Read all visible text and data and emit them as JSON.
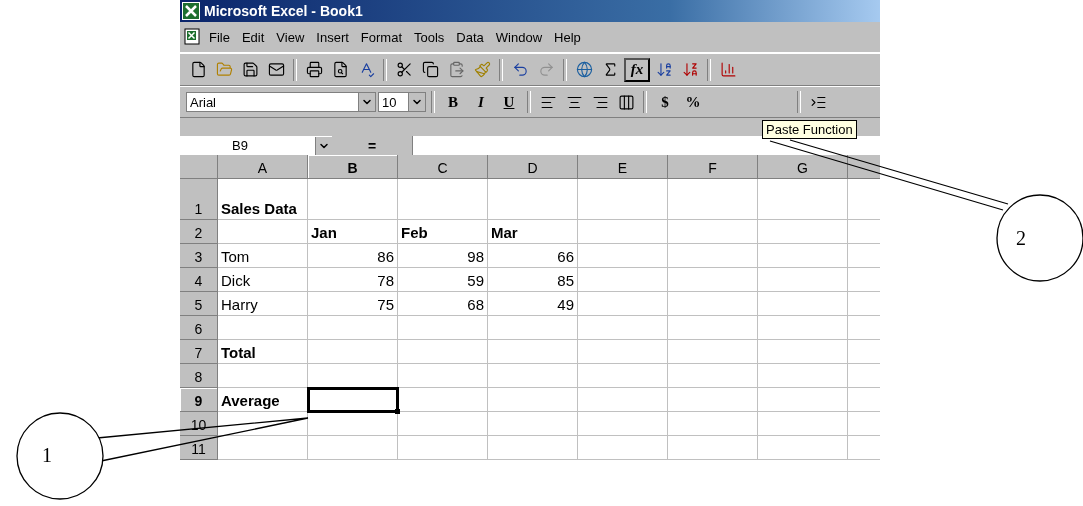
{
  "window": {
    "title": "Microsoft Excel - Book1"
  },
  "menu": [
    "File",
    "Edit",
    "View",
    "Insert",
    "Format",
    "Tools",
    "Data",
    "Window",
    "Help"
  ],
  "standard_toolbar": {
    "function_button": {
      "label": "fx",
      "highlighted": true
    }
  },
  "formatting_toolbar": {
    "font": "Arial",
    "size": "10",
    "style_buttons": [
      "B",
      "I",
      "U"
    ],
    "currency": "$",
    "percent": "%"
  },
  "tooltip": "Paste Function",
  "formula_bar": {
    "name_box": "B9",
    "equals": "="
  },
  "columns": [
    {
      "label": "A",
      "selected": false
    },
    {
      "label": "B",
      "selected": true
    },
    {
      "label": "C",
      "selected": false
    },
    {
      "label": "D",
      "selected": false
    },
    {
      "label": "E",
      "selected": false
    },
    {
      "label": "F",
      "selected": false
    },
    {
      "label": "G",
      "selected": false
    }
  ],
  "rows": [
    {
      "number": "1",
      "selected": false,
      "cells": [
        {
          "text": "Sales Data",
          "bold": true,
          "kind": "label",
          "selected": false
        },
        {
          "selected": false
        },
        {
          "selected": false
        },
        {
          "selected": false
        },
        {
          "selected": false
        },
        {
          "selected": false
        },
        {
          "selected": false
        }
      ]
    },
    {
      "number": "2",
      "selected": false,
      "cells": [
        {
          "selected": false
        },
        {
          "text": "Jan",
          "bold": true,
          "kind": "label",
          "selected": false
        },
        {
          "text": "Feb",
          "bold": true,
          "kind": "label",
          "selected": false
        },
        {
          "text": "Mar",
          "bold": true,
          "kind": "label",
          "selected": false
        },
        {
          "selected": false
        },
        {
          "selected": false
        },
        {
          "selected": false
        }
      ]
    },
    {
      "number": "3",
      "selected": false,
      "cells": [
        {
          "text": "Tom",
          "bold": false,
          "kind": "label",
          "selected": false
        },
        {
          "text": "86",
          "bold": false,
          "kind": "number",
          "selected": false
        },
        {
          "text": "98",
          "bold": false,
          "kind": "number",
          "selected": false
        },
        {
          "text": "66",
          "bold": false,
          "kind": "number",
          "selected": false
        },
        {
          "selected": false
        },
        {
          "selected": false
        },
        {
          "selected": false
        }
      ]
    },
    {
      "number": "4",
      "selected": false,
      "cells": [
        {
          "text": "Dick",
          "bold": false,
          "kind": "label",
          "selected": false
        },
        {
          "text": "78",
          "bold": false,
          "kind": "number",
          "selected": false
        },
        {
          "text": "59",
          "bold": false,
          "kind": "number",
          "selected": false
        },
        {
          "text": "85",
          "bold": false,
          "kind": "number",
          "selected": false
        },
        {
          "selected": false
        },
        {
          "selected": false
        },
        {
          "selected": false
        }
      ]
    },
    {
      "number": "5",
      "selected": false,
      "cells": [
        {
          "text": "Harry",
          "bold": false,
          "kind": "label",
          "selected": false
        },
        {
          "text": "75",
          "bold": false,
          "kind": "number",
          "selected": false
        },
        {
          "text": "68",
          "bold": false,
          "kind": "number",
          "selected": false
        },
        {
          "text": "49",
          "bold": false,
          "kind": "number",
          "selected": false
        },
        {
          "selected": false
        },
        {
          "selected": false
        },
        {
          "selected": false
        }
      ]
    },
    {
      "number": "6",
      "selected": false,
      "cells": [
        {
          "selected": false
        },
        {
          "selected": false
        },
        {
          "selected": false
        },
        {
          "selected": false
        },
        {
          "selected": false
        },
        {
          "selected": false
        },
        {
          "selected": false
        }
      ]
    },
    {
      "number": "7",
      "selected": false,
      "cells": [
        {
          "text": "Total",
          "bold": true,
          "kind": "label",
          "selected": false
        },
        {
          "selected": false
        },
        {
          "selected": false
        },
        {
          "selected": false
        },
        {
          "selected": false
        },
        {
          "selected": false
        },
        {
          "selected": false
        }
      ]
    },
    {
      "number": "8",
      "selected": false,
      "cells": [
        {
          "selected": false
        },
        {
          "selected": false
        },
        {
          "selected": false
        },
        {
          "selected": false
        },
        {
          "selected": false
        },
        {
          "selected": false
        },
        {
          "selected": false
        }
      ]
    },
    {
      "number": "9",
      "selected": true,
      "cells": [
        {
          "text": "Average",
          "bold": true,
          "kind": "label",
          "selected": false
        },
        {
          "selected": true
        },
        {
          "selected": false
        },
        {
          "selected": false
        },
        {
          "selected": false
        },
        {
          "selected": false
        },
        {
          "selected": false
        }
      ]
    },
    {
      "number": "10",
      "selected": false,
      "cells": [
        {
          "selected": false
        },
        {
          "selected": false
        },
        {
          "selected": false
        },
        {
          "selected": false
        },
        {
          "selected": false
        },
        {
          "selected": false
        },
        {
          "selected": false
        }
      ]
    },
    {
      "number": "11",
      "selected": false,
      "cells": [
        {
          "selected": false
        },
        {
          "selected": false
        },
        {
          "selected": false
        },
        {
          "selected": false
        },
        {
          "selected": false
        },
        {
          "selected": false
        },
        {
          "selected": false
        }
      ]
    }
  ],
  "callouts": [
    {
      "label": "1"
    },
    {
      "label": "2"
    }
  ]
}
